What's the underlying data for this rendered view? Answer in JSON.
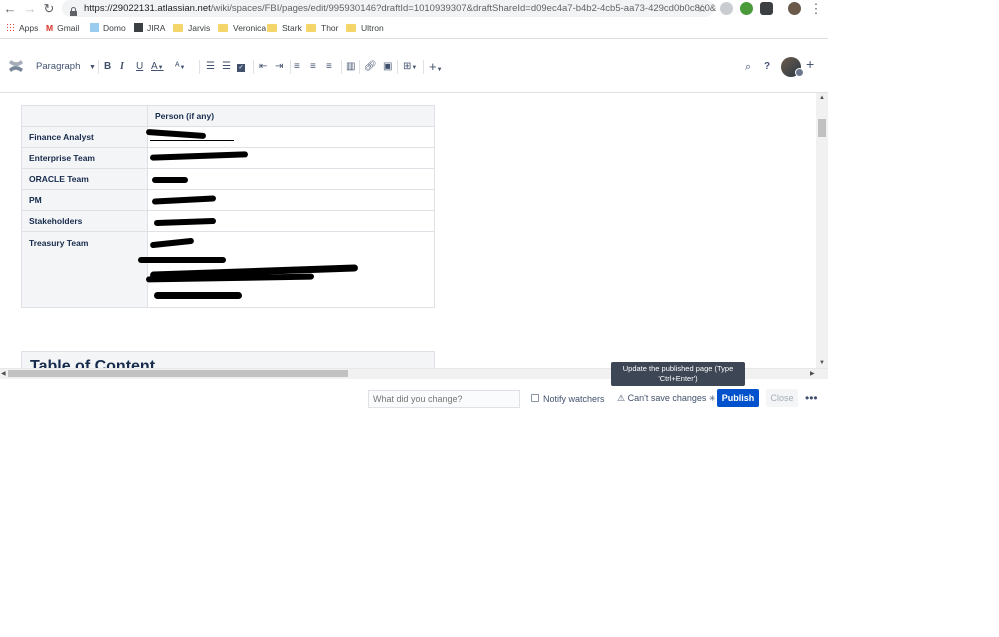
{
  "browser": {
    "url_host": "https://29022131.atlassian.net",
    "url_path": "/wiki/spaces/FBI/pages/edit/995930146?draftId=1010939307&draftShareId=d09ec4a7-b4b2-4cb5-aa73-429cd0b0c8c0&",
    "bookmarks": [
      "Apps",
      "Gmail",
      "Domo",
      "JIRA",
      "Jarvis",
      "Veronica",
      "Stark",
      "Thor",
      "Ultron"
    ]
  },
  "toolbar": {
    "paragraph_label": "Paragraph",
    "bold": "B",
    "italic": "I",
    "underline": "U",
    "text_color": "A",
    "add": "+"
  },
  "table": {
    "header": [
      "",
      "Person (if any)"
    ],
    "rows": [
      "Finance Analyst",
      "Enterprise Team",
      "ORACLE Team",
      "PM",
      "Stakeholders",
      "Treasury Team"
    ]
  },
  "toc_title": "Table of Content",
  "footer": {
    "change_placeholder": "What did you change?",
    "notify_label": "Notify watchers",
    "warning": "Can't save changes",
    "publish": "Publish",
    "close": "Close",
    "more": "•••"
  },
  "tooltip": {
    "line1": "Update the published page (Type",
    "line2": "'Ctrl+Enter')"
  },
  "colors": {
    "primary": "#0052cc",
    "tooltip_bg": "#3d4655"
  }
}
